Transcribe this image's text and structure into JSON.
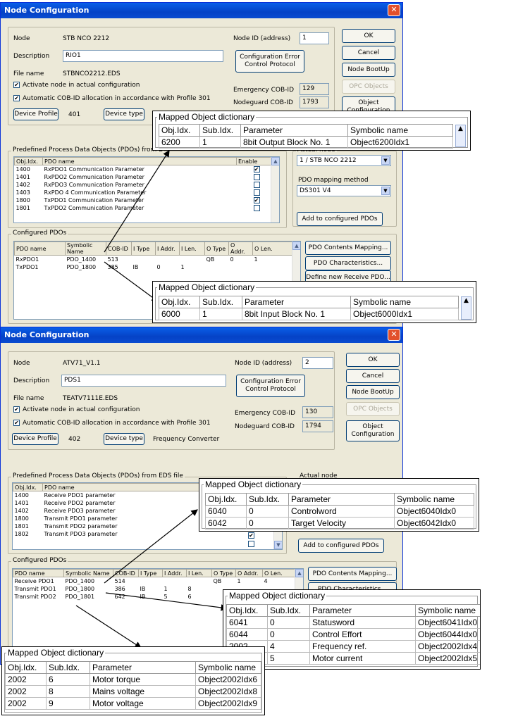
{
  "window1": {
    "title": "Node Configuration",
    "close": "✕",
    "node_label": "Node",
    "node_value": "STB NCO 2212",
    "node_id_label": "Node ID (address)",
    "node_id_value": "1",
    "desc_label": "Description",
    "desc_value": "RIO1",
    "file_label": "File name",
    "file_value": "STBNCO2212.EDS",
    "activate_label": "Activate node in actual configuration",
    "auto_cob_label": "Automatic COB-ID allocation in accordance with Profile 301",
    "device_profile_btn": "Device Profile",
    "device_profile_value": "401",
    "device_type_btn": "Device type",
    "emcy_label": "Emergency COB-ID",
    "emcy_value": "129",
    "nodeguard_label": "Nodeguard COB-ID",
    "nodeguard_value": "1793",
    "cfg_err_btn": "Configuration Error Control Protocol",
    "ok_btn": "OK",
    "cancel_btn": "Cancel",
    "bootup_btn": "Node BootUp",
    "opc_btn": "OPC Objects",
    "objcfg_btn": "Object Configuration",
    "predef_caption": "Predefined Process Data Objects (PDOs) from E",
    "predef_cols": [
      "Obj.Idx.",
      "PDO name",
      "Enable"
    ],
    "predef_rows": [
      [
        "1400",
        "RxPDO1 Communication Parameter",
        "✔"
      ],
      [
        "1401",
        "RxPDO2 Communication Parameter",
        ""
      ],
      [
        "1402",
        "RxPDO3 Communication Parameter",
        ""
      ],
      [
        "1403",
        "RxPDO 4 Communication Parameter",
        ""
      ],
      [
        "1800",
        "TxPDO1 Communication Parameter",
        "✔"
      ],
      [
        "1801",
        "TxPDO2 Communication Parameter",
        ""
      ]
    ],
    "actual_node_caption": "Actual node",
    "actual_node_value": "1 / STB NCO 2212",
    "mapping_caption": "PDO mapping method",
    "mapping_value": "DS301 V4",
    "add_pdos_btn": "Add to configured PDOs",
    "configured_caption": "Configured PDOs",
    "cfg_cols": [
      "PDO name",
      "Symbolic Name",
      "COB-ID",
      "I Type",
      "I Addr.",
      "I Len.",
      "O Type",
      "O Addr.",
      "O Len."
    ],
    "cfg_rows": [
      [
        "RxPDO1",
        "PDO_1400",
        "513",
        "",
        "",
        "",
        "QB",
        "0",
        "1"
      ],
      [
        "TxPDO1",
        "PDO_1800",
        "385",
        "IB",
        "0",
        "1",
        "",
        "",
        ""
      ]
    ],
    "contents_btn": "PDO Contents Mapping...",
    "char_btn": "PDO Characteristics...",
    "define_btn": "Define new Receive PDO..."
  },
  "window2": {
    "title": "Node Configuration",
    "close": "✕",
    "node_label": "Node",
    "node_value": "ATV71_V1.1",
    "node_id_label": "Node ID (address)",
    "node_id_value": "2",
    "desc_label": "Description",
    "desc_value": "PDS1",
    "file_label": "File name",
    "file_value": "TEATV7111E.EDS",
    "activate_label": "Activate node in actual configuration",
    "auto_cob_label": "Automatic COB-ID allocation in accordance with Profile 301",
    "device_profile_btn": "Device Profile",
    "device_profile_value": "402",
    "device_type_btn": "Device type",
    "device_type_value": "Frequency Converter",
    "emcy_label": "Emergency COB-ID",
    "emcy_value": "130",
    "nodeguard_label": "Nodeguard COB-ID",
    "nodeguard_value": "1794",
    "cfg_err_btn": "Configuration Error Control Protocol",
    "ok_btn": "OK",
    "cancel_btn": "Cancel",
    "bootup_btn": "Node BootUp",
    "opc_btn": "OPC Objects",
    "objcfg_btn": "Object Configuration",
    "predef_caption": "Predefined Process Data Objects (PDOs) from EDS file",
    "predef_cols": [
      "Obj.Idx.",
      "PDO name"
    ],
    "predef_rows": [
      [
        "1400",
        "Receive PDO1 parameter"
      ],
      [
        "1401",
        "Receive PDO2 parameter"
      ],
      [
        "1402",
        "Receive PDO3 parameter"
      ],
      [
        "1800",
        "Transmit PDO1 parameter"
      ],
      [
        "1801",
        "Transmit PDO2 parameter"
      ],
      [
        "1802",
        "Transmit PDO3 parameter"
      ]
    ],
    "actual_node_caption": "Actual node",
    "add_pdos_btn": "Add to configured PDOs",
    "configured_caption": "Configured PDOs",
    "cfg_cols": [
      "PDO name",
      "Symbolic Name",
      "COB-ID",
      "I Type",
      "I Addr.",
      "I Len.",
      "O Type",
      "O Addr.",
      "O Len."
    ],
    "cfg_rows": [
      [
        "Receive PDO1",
        "PDO_1400",
        "514",
        "",
        "",
        "",
        "QB",
        "1",
        "4"
      ],
      [
        "Transmit PDO1",
        "PDO_1800",
        "386",
        "IB",
        "1",
        "8",
        "",
        "",
        ""
      ],
      [
        "Transmit PDO2",
        "PDO_1801",
        "642",
        "IB",
        "5",
        "6",
        "",
        "",
        ""
      ]
    ],
    "contents_btn": "PDO Contents Mapping...",
    "char_btn": "PDO Characteristics..."
  },
  "mapped_title": "Mapped Object dictionary",
  "mapped_cols": [
    "Obj.Idx.",
    "Sub.Idx.",
    "Parameter",
    "Symbolic name"
  ],
  "popup_a": [
    [
      "6200",
      "1",
      "8bit Output Block No. 1",
      "Object6200Idx1"
    ]
  ],
  "popup_b": [
    [
      "6000",
      "1",
      "8bit Input Block No. 1",
      "Object6000Idx1"
    ]
  ],
  "popup_c": [
    [
      "6040",
      "0",
      "Controlword",
      "Object6040Idx0"
    ],
    [
      "6042",
      "0",
      "Target Velocity",
      "Object6042Idx0"
    ]
  ],
  "popup_d": [
    [
      "6041",
      "0",
      "Statusword",
      "Object6041Idx0"
    ],
    [
      "6044",
      "0",
      "Control Effort",
      "Object6044Idx0"
    ],
    [
      "2002",
      "4",
      "Frequency ref.",
      "Object2002Idx4"
    ],
    [
      "2002",
      "5",
      "Motor current",
      "Object2002Idx5"
    ]
  ],
  "popup_e": [
    [
      "2002",
      "6",
      "Motor torque",
      "Object2002Idx6"
    ],
    [
      "2002",
      "8",
      "Mains voltage",
      "Object2002Idx8"
    ],
    [
      "2002",
      "9",
      "Motor voltage",
      "Object2002Idx9"
    ]
  ]
}
